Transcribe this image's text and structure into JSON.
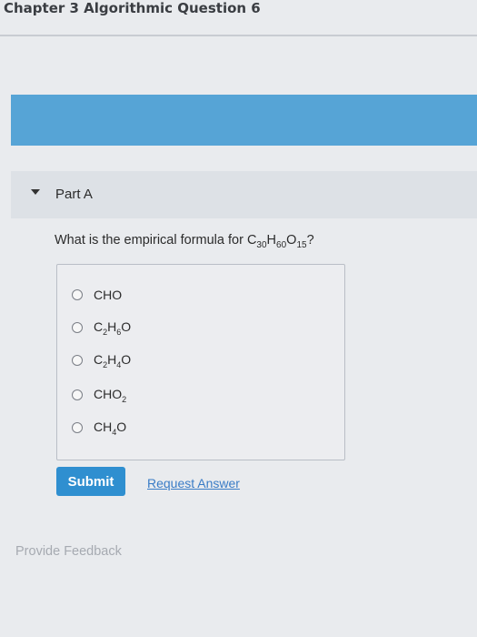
{
  "header": {
    "title": "Chapter 3 Algorithmic Question 6"
  },
  "part": {
    "label": "Part A"
  },
  "question": {
    "prefix": "What is the empirical formula for ",
    "formula": [
      {
        "t": "C"
      },
      {
        "sub": "30"
      },
      {
        "t": "H"
      },
      {
        "sub": "60"
      },
      {
        "t": "O"
      },
      {
        "sub": "15"
      }
    ],
    "suffix": "?"
  },
  "options": [
    {
      "id": "opt-cho",
      "parts": [
        {
          "t": "CHO"
        }
      ]
    },
    {
      "id": "opt-c2h6o",
      "parts": [
        {
          "t": "C"
        },
        {
          "sub": "2"
        },
        {
          "t": "H"
        },
        {
          "sub": "6"
        },
        {
          "t": "O"
        }
      ]
    },
    {
      "id": "opt-c2h4o",
      "parts": [
        {
          "t": "C"
        },
        {
          "sub": "2"
        },
        {
          "t": "H"
        },
        {
          "sub": "4"
        },
        {
          "t": "O"
        }
      ]
    },
    {
      "id": "opt-cho2",
      "parts": [
        {
          "t": "CHO"
        },
        {
          "sub": "2"
        }
      ]
    },
    {
      "id": "opt-ch4o",
      "parts": [
        {
          "t": "CH"
        },
        {
          "sub": "4"
        },
        {
          "t": "O"
        }
      ]
    }
  ],
  "actions": {
    "submit_label": "Submit",
    "request_answer_label": "Request Answer"
  },
  "footer": {
    "feedback_label": "Provide Feedback"
  },
  "colors": {
    "banner": "#56a4d6",
    "submit": "#2f8fd0",
    "link": "#3a7cc6"
  }
}
